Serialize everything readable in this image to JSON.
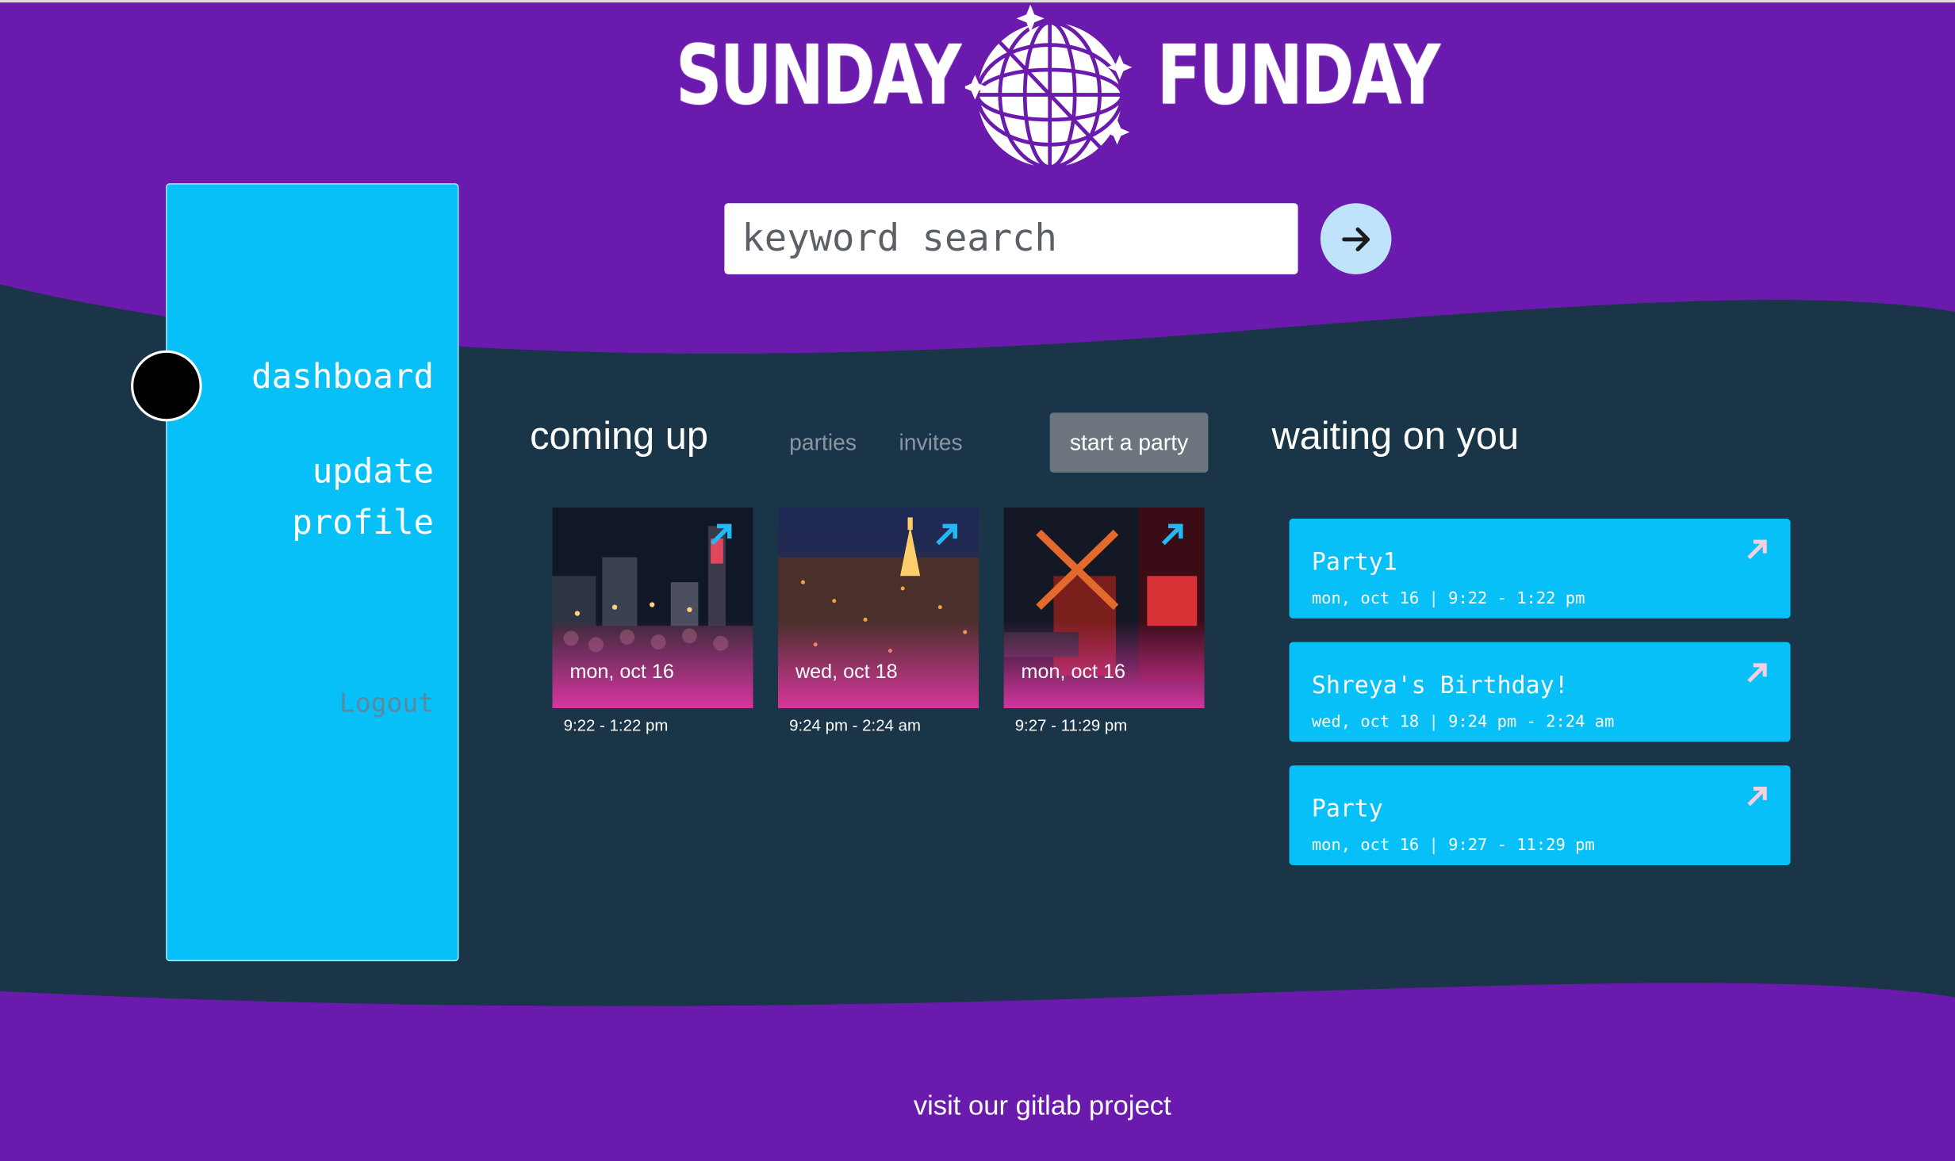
{
  "brand": {
    "word1": "SUNDAY",
    "word2": "FUNDAY"
  },
  "search": {
    "placeholder": "keyword search",
    "value": ""
  },
  "sidebar": {
    "items": [
      {
        "label": "dashboard"
      },
      {
        "label": "update profile"
      }
    ],
    "logout_label": "Logout"
  },
  "coming_up": {
    "title": "coming up",
    "tabs": [
      {
        "label": "parties"
      },
      {
        "label": "invites"
      }
    ],
    "start_button": "start a party",
    "cards": [
      {
        "date": "mon, oct 16",
        "time": "9:22 - 1:22 pm",
        "scene": "rooftop-party-night-city"
      },
      {
        "date": "wed, oct 18",
        "time": "9:24 pm - 2:24 am",
        "scene": "paris-eiffel-tower-night"
      },
      {
        "date": "mon, oct 16",
        "time": "9:27 - 11:29 pm",
        "scene": "moulin-rouge-windmill"
      }
    ]
  },
  "waiting": {
    "title": "waiting on you",
    "items": [
      {
        "title": "Party1",
        "meta": "mon, oct 16 | 9:22 - 1:22 pm"
      },
      {
        "title": "Shreya's Birthday!",
        "meta": "wed, oct 18 | 9:24 pm - 2:24 am"
      },
      {
        "title": "Party",
        "meta": "mon, oct 16 | 9:27 - 11:29 pm"
      }
    ]
  },
  "footer": {
    "link": "visit our gitlab project"
  },
  "colors": {
    "purple": "#6a1aad",
    "navy": "#1b3548",
    "cyan": "#07c0f7",
    "gray_button": "#6c757d",
    "pink": "#e837aa"
  },
  "icons": [
    "globe-disco-icon",
    "arrow-right-icon",
    "arrow-up-right-icon"
  ]
}
